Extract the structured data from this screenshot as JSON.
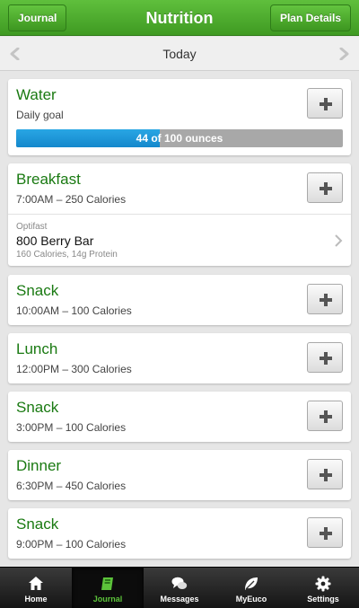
{
  "header": {
    "title": "Nutrition",
    "back_label": "Journal",
    "plan_label": "Plan Details"
  },
  "datebar": {
    "date": "Today"
  },
  "water": {
    "name": "Water",
    "subtitle": "Daily goal",
    "progress_text": "44 of 100 ounces",
    "progress_fraction": 0.44
  },
  "meals": [
    {
      "name": "Breakfast",
      "detail": "7:00AM – 250 Calories"
    },
    {
      "name": "Snack",
      "detail": "10:00AM – 100 Calories"
    },
    {
      "name": "Lunch",
      "detail": "12:00PM – 300 Calories"
    },
    {
      "name": "Snack",
      "detail": "3:00PM – 100 Calories"
    },
    {
      "name": "Dinner",
      "detail": "6:30PM – 450 Calories"
    },
    {
      "name": "Snack",
      "detail": "9:00PM – 100 Calories"
    }
  ],
  "breakfast_entry": {
    "brand": "Optifast",
    "name": "800 Berry Bar",
    "detail": "160 Calories, 14g Protein"
  },
  "tabs": [
    {
      "label": "Home",
      "icon": "home-icon"
    },
    {
      "label": "Journal",
      "icon": "journal-icon"
    },
    {
      "label": "Messages",
      "icon": "messages-icon"
    },
    {
      "label": "MyEuco",
      "icon": "leaf-icon"
    },
    {
      "label": "Settings",
      "icon": "gear-icon"
    }
  ],
  "colors": {
    "header_green": "#4caf2e",
    "meal_title_green": "#1a7a12",
    "progress_blue": "#1e98d8",
    "active_tab_green": "#5cc33a"
  }
}
